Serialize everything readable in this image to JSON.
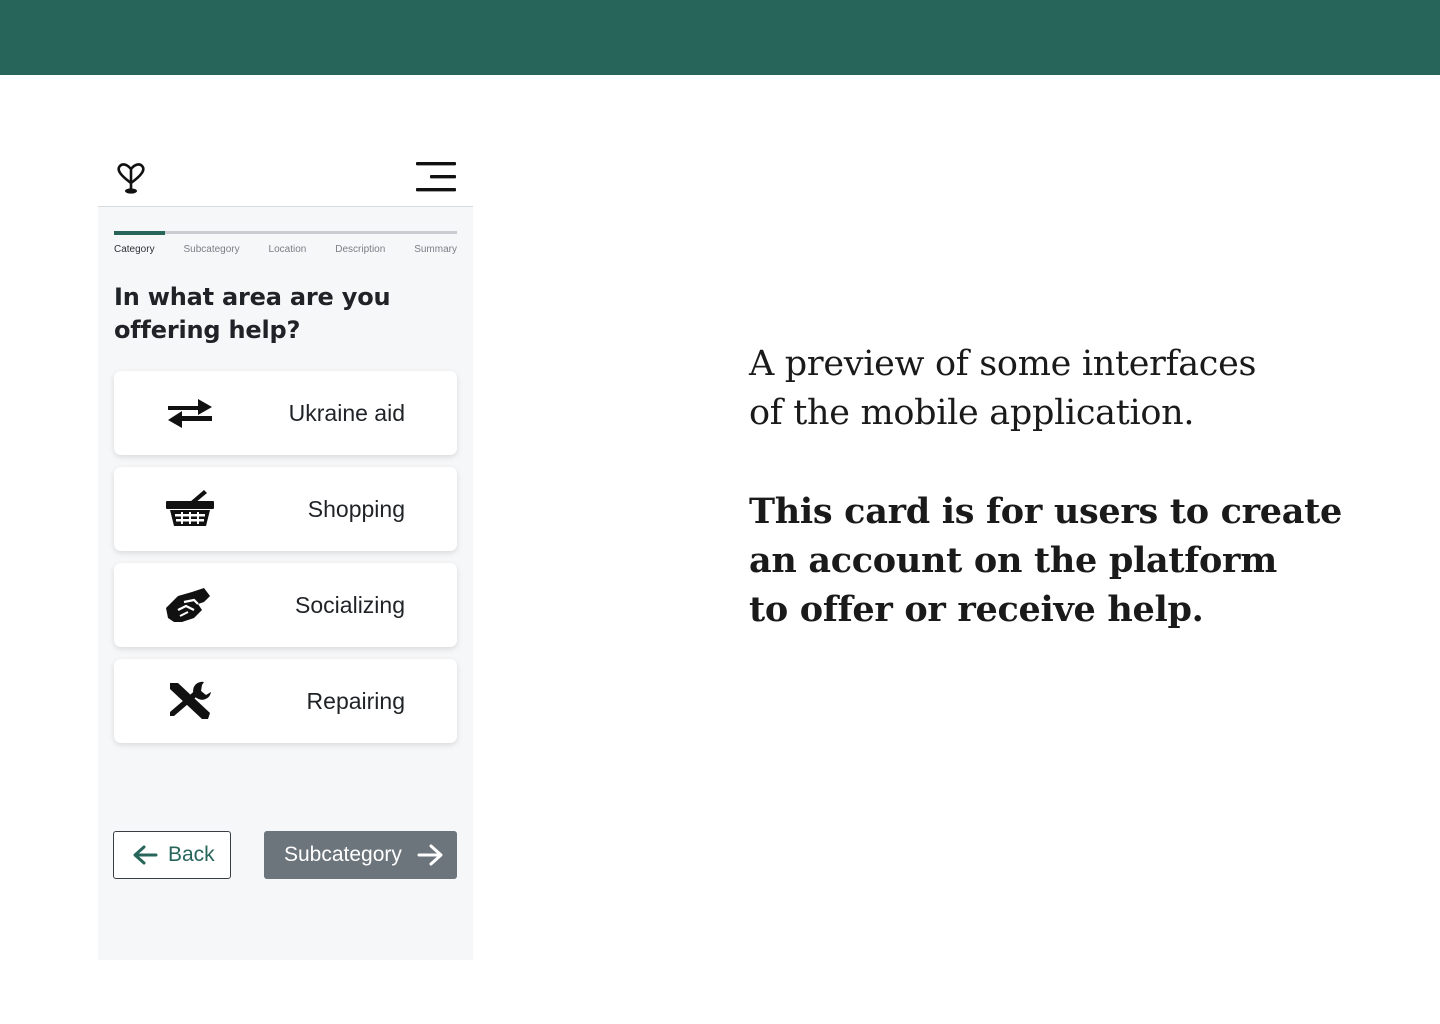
{
  "colors": {
    "brand_green": "#27655b",
    "button_gray": "#6c747c",
    "phone_bg": "#f6f7f8"
  },
  "app": {
    "progress": {
      "completed_fraction": 0.15,
      "active_step": 0
    },
    "steps": [
      "Category",
      "Subcategory",
      "Location",
      "Description",
      "Summary"
    ],
    "question": "In what area are you offering help?",
    "categories": [
      {
        "label": "Ukraine aid",
        "icon": "swap-arrows-icon"
      },
      {
        "label": "Shopping",
        "icon": "basket-icon"
      },
      {
        "label": "Socializing",
        "icon": "handshake-icon"
      },
      {
        "label": "Repairing",
        "icon": "tools-icon"
      }
    ],
    "back_label": "Back",
    "next_label": "Subcategory"
  },
  "description": {
    "intro_lines": [
      "A preview of some interfaces",
      "of the mobile application."
    ],
    "main_lines": [
      "This card is for users to create",
      "an account on the platform",
      "to offer or receive help."
    ]
  }
}
